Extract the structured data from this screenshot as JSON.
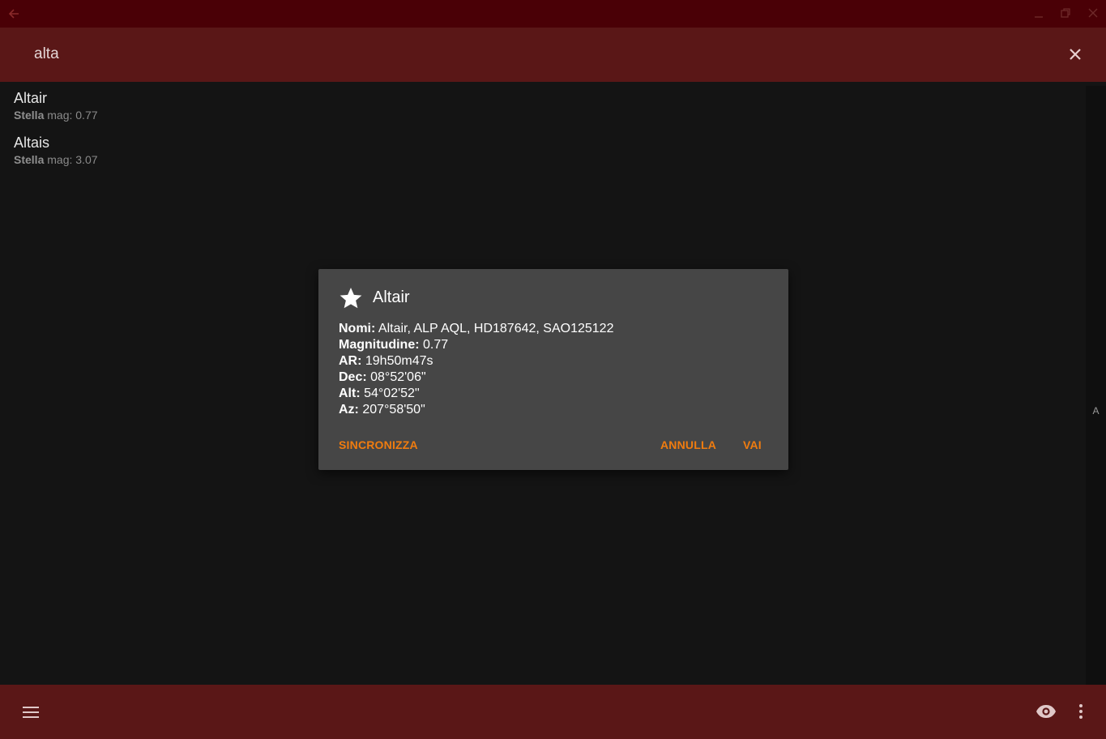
{
  "colors": {
    "titlebar": "#4a0006",
    "appbar": "#5a1717",
    "background": "#141414",
    "dialog": "#464646",
    "accent": "#f07c0f"
  },
  "titlebar": {
    "icons": [
      "back-arrow-icon",
      "minimize-icon",
      "restore-icon",
      "close-icon"
    ]
  },
  "search": {
    "query": "alta",
    "clear_icon": "close-icon"
  },
  "results": [
    {
      "name": "Altair",
      "type": "Stella",
      "mag": "mag: 0.77"
    },
    {
      "name": "Altais",
      "type": "Stella",
      "mag": "mag: 3.07"
    }
  ],
  "scroll_index_letter": "A",
  "dialog": {
    "icon": "star-icon",
    "title": "Altair",
    "rows": [
      {
        "label": "Nomi:",
        "value": " Altair, ALP AQL, HD187642, SAO125122"
      },
      {
        "label": "Magnitudine:",
        "value": " 0.77"
      },
      {
        "label": "AR:",
        "value": " 19h50m47s"
      },
      {
        "label": "Dec:",
        "value": " 08°52'06\""
      },
      {
        "label": "Alt:",
        "value": " 54°02'52\""
      },
      {
        "label": "Az:",
        "value": " 207°58'50\""
      }
    ],
    "buttons": {
      "sync": "SINCRONIZZA",
      "cancel": "ANNULLA",
      "go": "VAI"
    }
  },
  "bottombar": {
    "icons": [
      "menu-icon",
      "eye-icon",
      "more-vert-icon"
    ]
  }
}
